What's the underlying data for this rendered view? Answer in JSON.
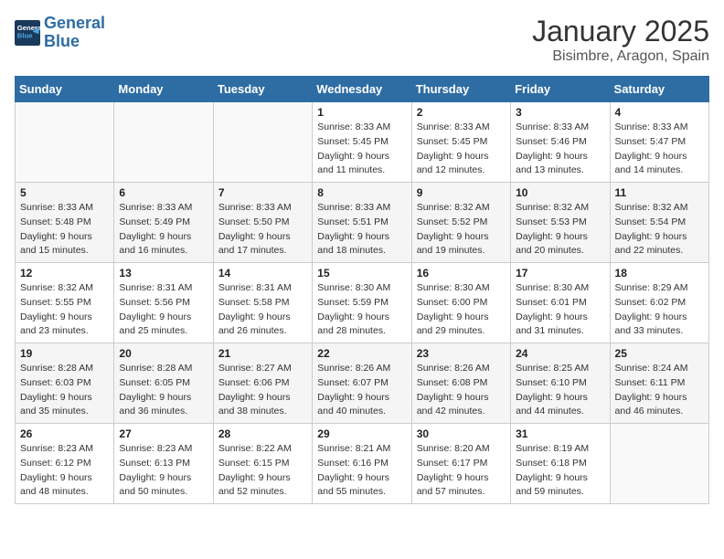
{
  "header": {
    "logo_line1": "General",
    "logo_line2": "Blue",
    "title": "January 2025",
    "subtitle": "Bisimbre, Aragon, Spain"
  },
  "days_of_week": [
    "Sunday",
    "Monday",
    "Tuesday",
    "Wednesday",
    "Thursday",
    "Friday",
    "Saturday"
  ],
  "weeks": [
    [
      {
        "num": "",
        "sunrise": "",
        "sunset": "",
        "daylight": ""
      },
      {
        "num": "",
        "sunrise": "",
        "sunset": "",
        "daylight": ""
      },
      {
        "num": "",
        "sunrise": "",
        "sunset": "",
        "daylight": ""
      },
      {
        "num": "1",
        "sunrise": "Sunrise: 8:33 AM",
        "sunset": "Sunset: 5:45 PM",
        "daylight": "Daylight: 9 hours and 11 minutes."
      },
      {
        "num": "2",
        "sunrise": "Sunrise: 8:33 AM",
        "sunset": "Sunset: 5:45 PM",
        "daylight": "Daylight: 9 hours and 12 minutes."
      },
      {
        "num": "3",
        "sunrise": "Sunrise: 8:33 AM",
        "sunset": "Sunset: 5:46 PM",
        "daylight": "Daylight: 9 hours and 13 minutes."
      },
      {
        "num": "4",
        "sunrise": "Sunrise: 8:33 AM",
        "sunset": "Sunset: 5:47 PM",
        "daylight": "Daylight: 9 hours and 14 minutes."
      }
    ],
    [
      {
        "num": "5",
        "sunrise": "Sunrise: 8:33 AM",
        "sunset": "Sunset: 5:48 PM",
        "daylight": "Daylight: 9 hours and 15 minutes."
      },
      {
        "num": "6",
        "sunrise": "Sunrise: 8:33 AM",
        "sunset": "Sunset: 5:49 PM",
        "daylight": "Daylight: 9 hours and 16 minutes."
      },
      {
        "num": "7",
        "sunrise": "Sunrise: 8:33 AM",
        "sunset": "Sunset: 5:50 PM",
        "daylight": "Daylight: 9 hours and 17 minutes."
      },
      {
        "num": "8",
        "sunrise": "Sunrise: 8:33 AM",
        "sunset": "Sunset: 5:51 PM",
        "daylight": "Daylight: 9 hours and 18 minutes."
      },
      {
        "num": "9",
        "sunrise": "Sunrise: 8:32 AM",
        "sunset": "Sunset: 5:52 PM",
        "daylight": "Daylight: 9 hours and 19 minutes."
      },
      {
        "num": "10",
        "sunrise": "Sunrise: 8:32 AM",
        "sunset": "Sunset: 5:53 PM",
        "daylight": "Daylight: 9 hours and 20 minutes."
      },
      {
        "num": "11",
        "sunrise": "Sunrise: 8:32 AM",
        "sunset": "Sunset: 5:54 PM",
        "daylight": "Daylight: 9 hours and 22 minutes."
      }
    ],
    [
      {
        "num": "12",
        "sunrise": "Sunrise: 8:32 AM",
        "sunset": "Sunset: 5:55 PM",
        "daylight": "Daylight: 9 hours and 23 minutes."
      },
      {
        "num": "13",
        "sunrise": "Sunrise: 8:31 AM",
        "sunset": "Sunset: 5:56 PM",
        "daylight": "Daylight: 9 hours and 25 minutes."
      },
      {
        "num": "14",
        "sunrise": "Sunrise: 8:31 AM",
        "sunset": "Sunset: 5:58 PM",
        "daylight": "Daylight: 9 hours and 26 minutes."
      },
      {
        "num": "15",
        "sunrise": "Sunrise: 8:30 AM",
        "sunset": "Sunset: 5:59 PM",
        "daylight": "Daylight: 9 hours and 28 minutes."
      },
      {
        "num": "16",
        "sunrise": "Sunrise: 8:30 AM",
        "sunset": "Sunset: 6:00 PM",
        "daylight": "Daylight: 9 hours and 29 minutes."
      },
      {
        "num": "17",
        "sunrise": "Sunrise: 8:30 AM",
        "sunset": "Sunset: 6:01 PM",
        "daylight": "Daylight: 9 hours and 31 minutes."
      },
      {
        "num": "18",
        "sunrise": "Sunrise: 8:29 AM",
        "sunset": "Sunset: 6:02 PM",
        "daylight": "Daylight: 9 hours and 33 minutes."
      }
    ],
    [
      {
        "num": "19",
        "sunrise": "Sunrise: 8:28 AM",
        "sunset": "Sunset: 6:03 PM",
        "daylight": "Daylight: 9 hours and 35 minutes."
      },
      {
        "num": "20",
        "sunrise": "Sunrise: 8:28 AM",
        "sunset": "Sunset: 6:05 PM",
        "daylight": "Daylight: 9 hours and 36 minutes."
      },
      {
        "num": "21",
        "sunrise": "Sunrise: 8:27 AM",
        "sunset": "Sunset: 6:06 PM",
        "daylight": "Daylight: 9 hours and 38 minutes."
      },
      {
        "num": "22",
        "sunrise": "Sunrise: 8:26 AM",
        "sunset": "Sunset: 6:07 PM",
        "daylight": "Daylight: 9 hours and 40 minutes."
      },
      {
        "num": "23",
        "sunrise": "Sunrise: 8:26 AM",
        "sunset": "Sunset: 6:08 PM",
        "daylight": "Daylight: 9 hours and 42 minutes."
      },
      {
        "num": "24",
        "sunrise": "Sunrise: 8:25 AM",
        "sunset": "Sunset: 6:10 PM",
        "daylight": "Daylight: 9 hours and 44 minutes."
      },
      {
        "num": "25",
        "sunrise": "Sunrise: 8:24 AM",
        "sunset": "Sunset: 6:11 PM",
        "daylight": "Daylight: 9 hours and 46 minutes."
      }
    ],
    [
      {
        "num": "26",
        "sunrise": "Sunrise: 8:23 AM",
        "sunset": "Sunset: 6:12 PM",
        "daylight": "Daylight: 9 hours and 48 minutes."
      },
      {
        "num": "27",
        "sunrise": "Sunrise: 8:23 AM",
        "sunset": "Sunset: 6:13 PM",
        "daylight": "Daylight: 9 hours and 50 minutes."
      },
      {
        "num": "28",
        "sunrise": "Sunrise: 8:22 AM",
        "sunset": "Sunset: 6:15 PM",
        "daylight": "Daylight: 9 hours and 52 minutes."
      },
      {
        "num": "29",
        "sunrise": "Sunrise: 8:21 AM",
        "sunset": "Sunset: 6:16 PM",
        "daylight": "Daylight: 9 hours and 55 minutes."
      },
      {
        "num": "30",
        "sunrise": "Sunrise: 8:20 AM",
        "sunset": "Sunset: 6:17 PM",
        "daylight": "Daylight: 9 hours and 57 minutes."
      },
      {
        "num": "31",
        "sunrise": "Sunrise: 8:19 AM",
        "sunset": "Sunset: 6:18 PM",
        "daylight": "Daylight: 9 hours and 59 minutes."
      },
      {
        "num": "",
        "sunrise": "",
        "sunset": "",
        "daylight": ""
      }
    ]
  ]
}
